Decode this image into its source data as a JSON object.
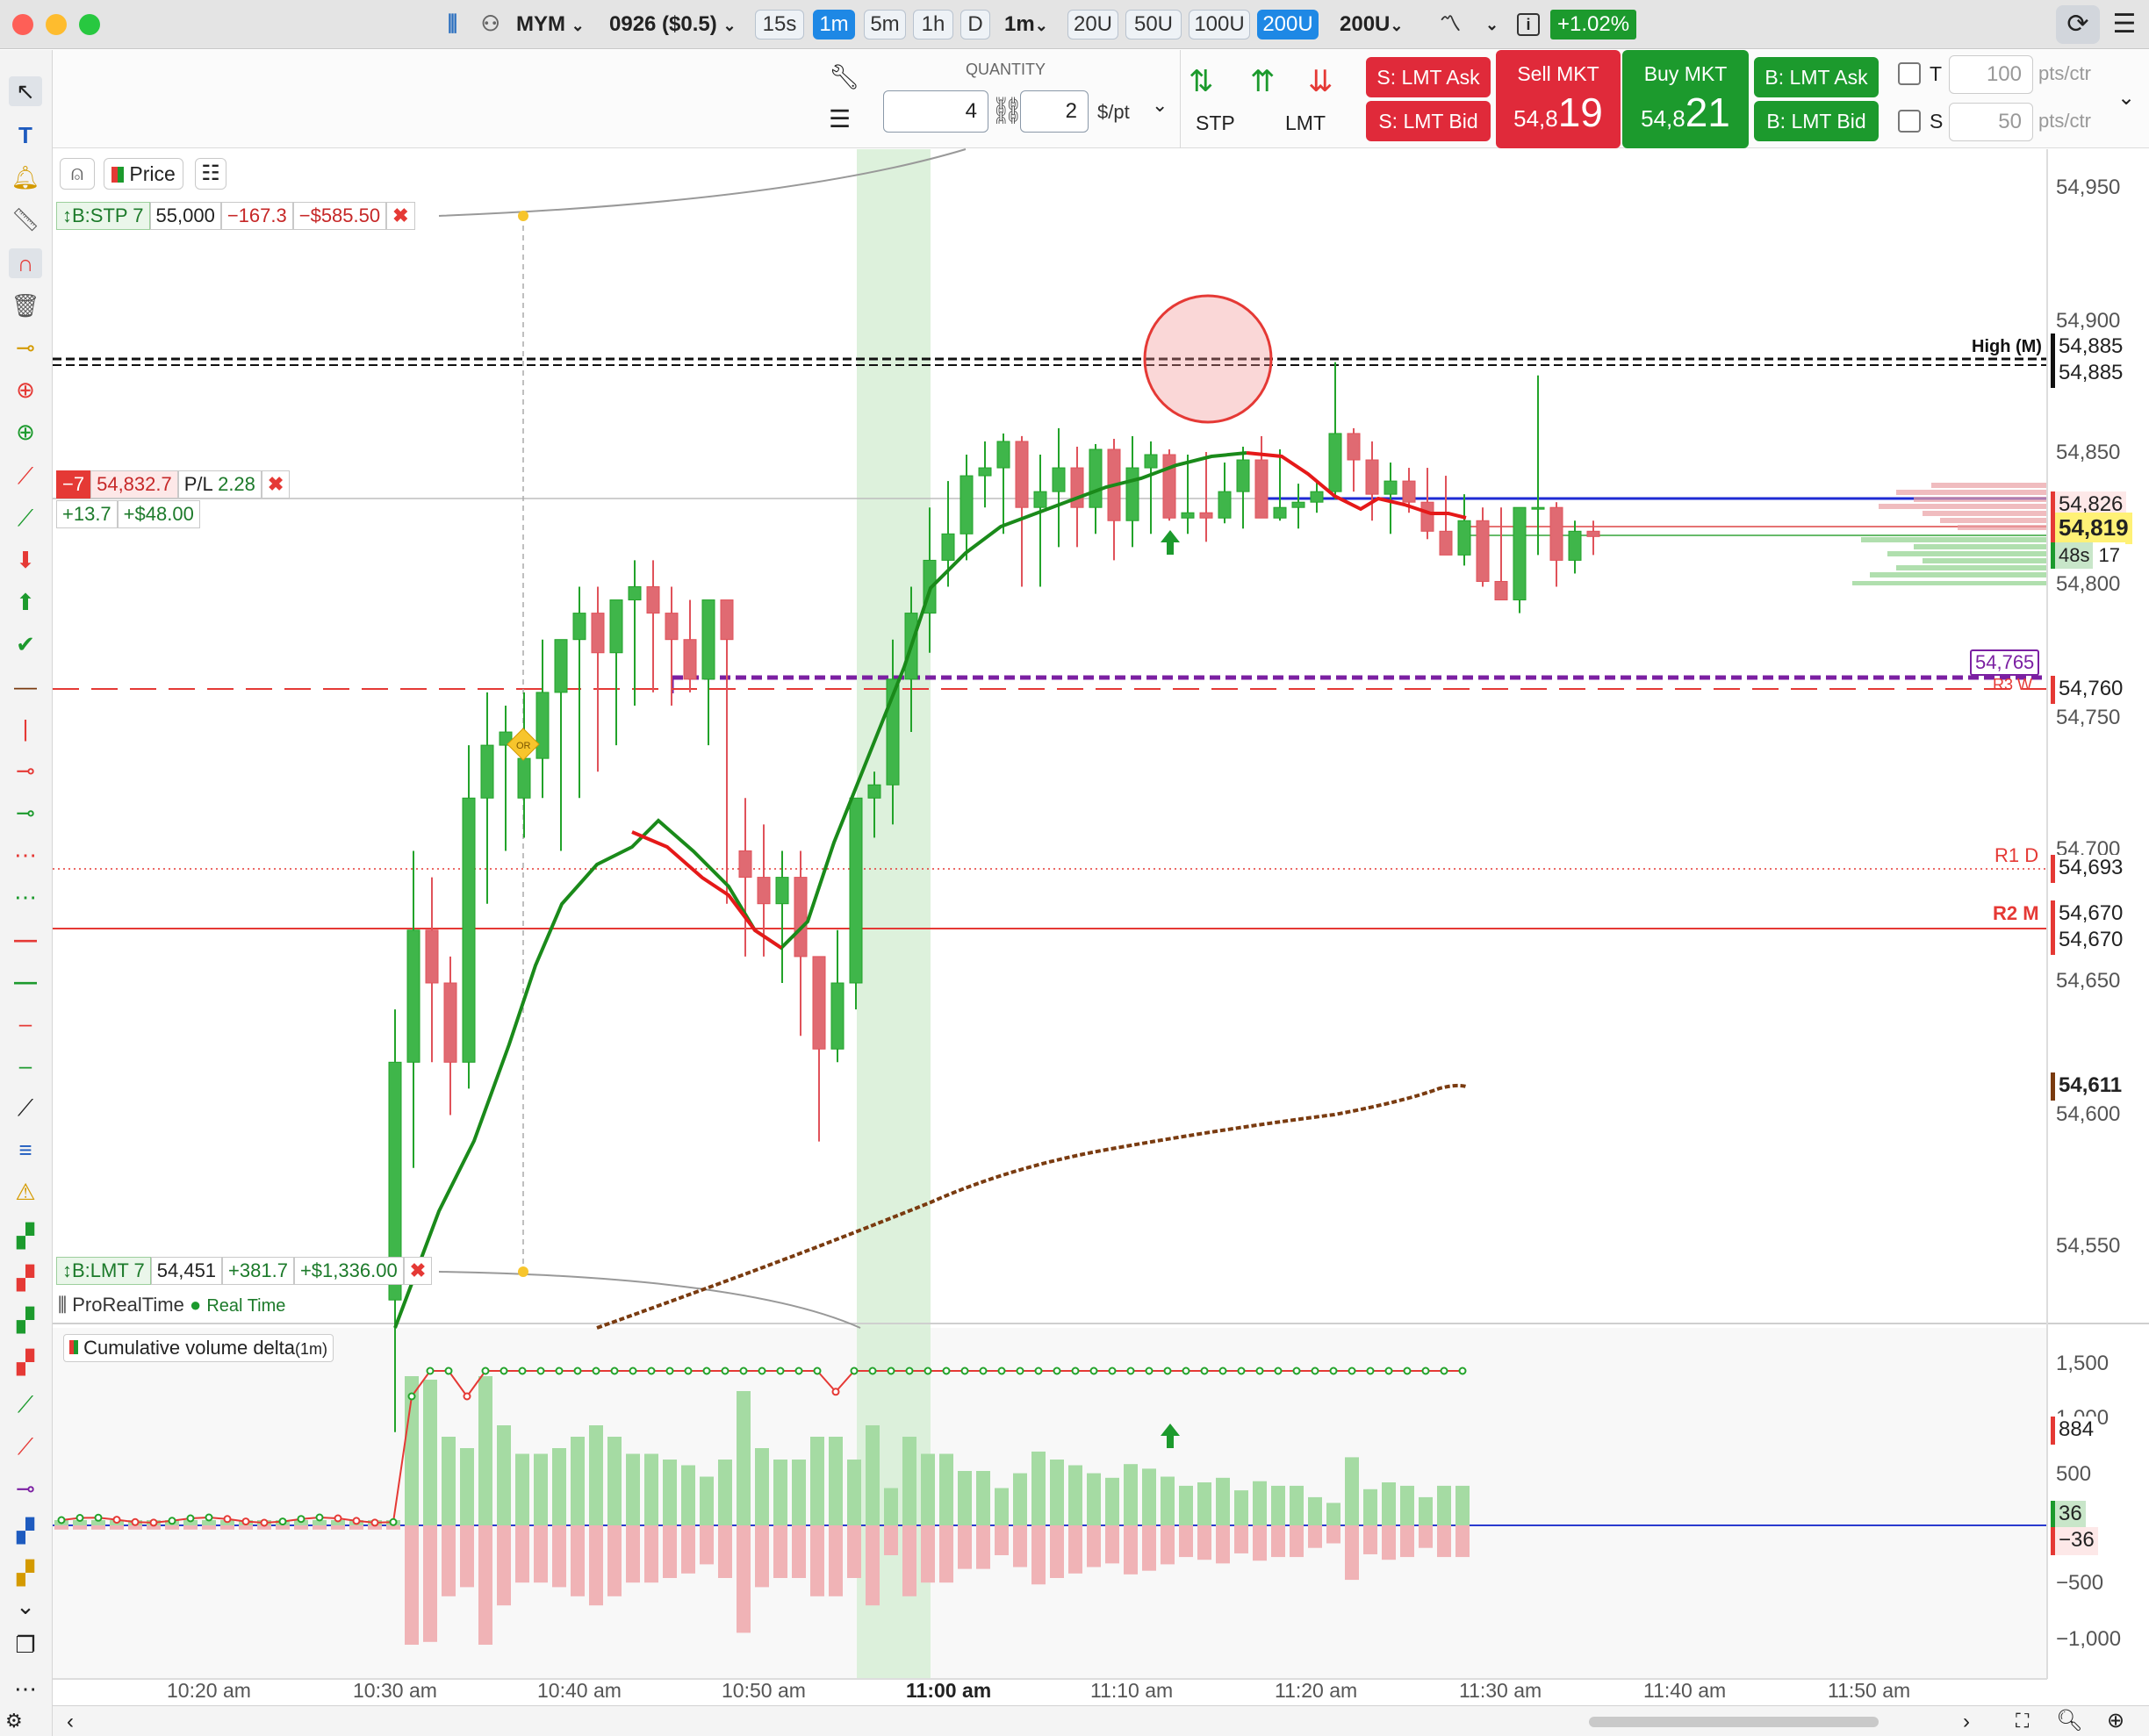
{
  "titlebar": {
    "symbol": "MYM",
    "contract": "0926 ($0.5)",
    "intervals": [
      "15s",
      "1m",
      "5m",
      "1h",
      "D"
    ],
    "active_interval": "1m",
    "bar_type": "1m",
    "units": [
      "20U",
      "50U",
      "100U",
      "200U"
    ],
    "active_unit": "200U",
    "range": "200U",
    "change": "+1.02%"
  },
  "order_panel": {
    "quantity_label": "QUANTITY",
    "quantity": "4",
    "points": "2",
    "unit": "$/pt",
    "stp_label": "STP",
    "lmt_label": "LMT",
    "s_lmt_ask": "S: LMT Ask",
    "s_lmt_bid": "S: LMT Bid",
    "sell_mkt": "Sell MKT",
    "sell_price_small": "54,8",
    "sell_price_big": "19",
    "buy_mkt": "Buy MKT",
    "buy_price_small": "54,8",
    "buy_price_big": "21",
    "b_lmt_ask": "B: LMT Ask",
    "b_lmt_bid": "B: LMT Bid",
    "t_label": "T",
    "t_value": "100",
    "t_unit": "pts/ctr",
    "s_label": "S",
    "s_value": "50",
    "s_unit": "pts/ctr"
  },
  "chart_header": {
    "price_label": "Price"
  },
  "orders": {
    "stop": {
      "label": "B:STP 7",
      "price": "55,000",
      "pts": "−167.3",
      "usd": "−$585.50"
    },
    "position": {
      "qty": "−7",
      "price": "54,832.7",
      "pl_label": "P/L",
      "pl": "2.28",
      "pts": "+13.7",
      "usd": "+$48.00"
    },
    "limit": {
      "label": "B:LMT 7",
      "price": "54,451",
      "pts": "+381.7",
      "usd": "+$1,336.00"
    }
  },
  "source": {
    "name": "ProRealTime",
    "status": "Real Time"
  },
  "indicator": {
    "name": "Cumulative volume delta",
    "period": "(1m)"
  },
  "price_axis": {
    "ticks": [
      "54,950",
      "54,900",
      "54,850",
      "54,800",
      "54,750",
      "54,700",
      "54,650",
      "54,600",
      "54,550"
    ],
    "labels": {
      "high": "54,885",
      "high2": "54,885",
      "high_tag": "High (M)",
      "line_826": "54,826",
      "last": "54,819",
      "timer": "48s",
      "timer_count": "17",
      "purple": "54,765",
      "r3": "54,760",
      "r3_tag": "R3 W",
      "r1": "54,693",
      "r1_tag": "R1 D",
      "r2a": "54,670",
      "r2b": "54,670",
      "r2_tag": "R2 M",
      "ma": "54,611"
    }
  },
  "cvd_axis": {
    "ticks": [
      "1,500",
      "1,000",
      "500",
      "−500",
      "−1,000"
    ],
    "value": "884",
    "pos": "36",
    "neg": "−36"
  },
  "time_axis": [
    "10:20 am",
    "10:30 am",
    "10:40 am",
    "10:50 am",
    "11:00 am",
    "11:10 am",
    "11:20 am",
    "11:30 am",
    "11:40 am",
    "11:50 am"
  ],
  "colors": {
    "up": "#22a32a",
    "down": "#e0525a",
    "accent": "#1e88e5",
    "ma_fast": "#1a8a1a",
    "ma_slow": "#7a3b10"
  },
  "chart_data": {
    "type": "candlestick",
    "interval": "1m",
    "candles_ohlc": [
      [
        54530,
        54640,
        54480,
        54620
      ],
      [
        54620,
        54700,
        54580,
        54670
      ],
      [
        54670,
        54690,
        54620,
        54650
      ],
      [
        54650,
        54660,
        54600,
        54620
      ],
      [
        54620,
        54740,
        54610,
        54720
      ],
      [
        54720,
        54760,
        54680,
        54740
      ],
      [
        54740,
        54755,
        54700,
        54745
      ],
      [
        54720,
        54760,
        54705,
        54735
      ],
      [
        54735,
        54780,
        54720,
        54760
      ],
      [
        54760,
        54770,
        54700,
        54780
      ],
      [
        54780,
        54800,
        54720,
        54790
      ],
      [
        54790,
        54800,
        54730,
        54775
      ],
      [
        54775,
        54795,
        54740,
        54795
      ],
      [
        54795,
        54810,
        54755,
        54800
      ],
      [
        54800,
        54810,
        54760,
        54790
      ],
      [
        54790,
        54800,
        54755,
        54780
      ],
      [
        54780,
        54795,
        54760,
        54765
      ],
      [
        54765,
        54790,
        54740,
        54795
      ],
      [
        54795,
        54790,
        54680,
        54780
      ],
      [
        54700,
        54720,
        54660,
        54690
      ],
      [
        54690,
        54710,
        54660,
        54680
      ],
      [
        54680,
        54700,
        54650,
        54690
      ],
      [
        54690,
        54700,
        54630,
        54660
      ],
      [
        54660,
        54660,
        54590,
        54625
      ],
      [
        54625,
        54670,
        54620,
        54650
      ],
      [
        54650,
        54720,
        54640,
        54720
      ],
      [
        54720,
        54730,
        54705,
        54725
      ],
      [
        54725,
        54780,
        54710,
        54765
      ],
      [
        54765,
        54800,
        54745,
        54790
      ],
      [
        54790,
        54830,
        54775,
        54810
      ],
      [
        54810,
        54840,
        54800,
        54820
      ],
      [
        54820,
        54850,
        54810,
        54842
      ],
      [
        54842,
        54855,
        54830,
        54845
      ],
      [
        54845,
        54858,
        54820,
        54855
      ],
      [
        54855,
        54857,
        54800,
        54830
      ],
      [
        54830,
        54850,
        54800,
        54836
      ],
      [
        54836,
        54860,
        54815,
        54845
      ],
      [
        54845,
        54853,
        54815,
        54830
      ],
      [
        54830,
        54854,
        54820,
        54852
      ],
      [
        54852,
        54856,
        54810,
        54825
      ],
      [
        54825,
        54857,
        54815,
        54845
      ],
      [
        54845,
        54855,
        54820,
        54850
      ],
      [
        54850,
        54852,
        54825,
        54826
      ],
      [
        54826,
        54850,
        54820,
        54828
      ],
      [
        54828,
        54851,
        54817,
        54826
      ],
      [
        54826,
        54847,
        54824,
        54836
      ],
      [
        54836,
        54853,
        54822,
        54848
      ],
      [
        54848,
        54857,
        54830,
        54826
      ],
      [
        54826,
        54852,
        54825,
        54830
      ],
      [
        54830,
        54839,
        54822,
        54832
      ],
      [
        54832,
        54840,
        54828,
        54836
      ],
      [
        54836,
        54885,
        54833,
        54858
      ],
      [
        54858,
        54860,
        54836,
        54848
      ],
      [
        54848,
        54855,
        54825,
        54835
      ],
      [
        54835,
        54847,
        54820,
        54840
      ],
      [
        54840,
        54845,
        54828,
        54832
      ],
      [
        54832,
        54845,
        54818,
        54821
      ],
      [
        54821,
        54842,
        54815,
        54812
      ],
      [
        54812,
        54835,
        54808,
        54825
      ],
      [
        54825,
        54830,
        54800,
        54802
      ],
      [
        54802,
        54830,
        54795,
        54795
      ],
      [
        54795,
        54815,
        54790,
        54830
      ],
      [
        54830,
        54880,
        54812,
        54830
      ],
      [
        54830,
        54832,
        54800,
        54810
      ],
      [
        54810,
        54825,
        54805,
        54821
      ],
      [
        54821,
        54825,
        54812,
        54819
      ]
    ],
    "cvd_labels": {
      "current": 884
    }
  }
}
